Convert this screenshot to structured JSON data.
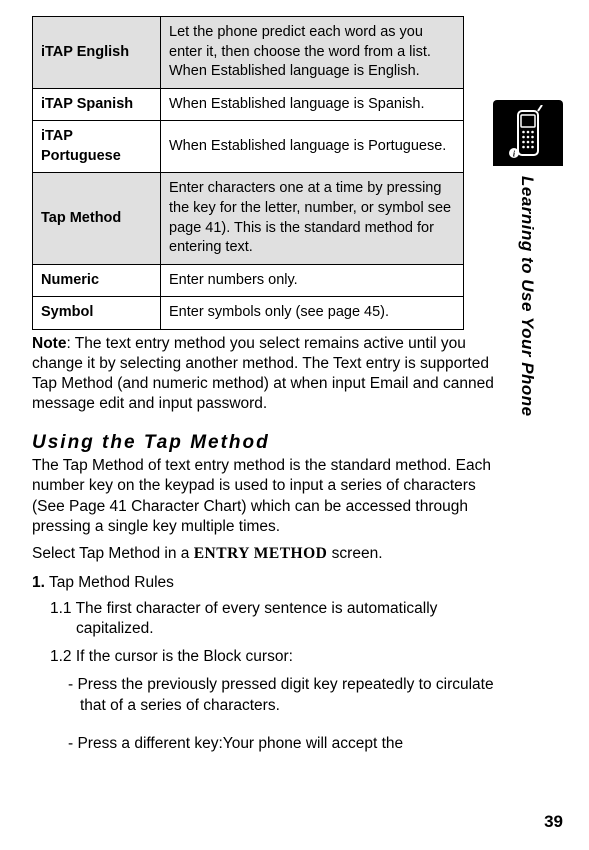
{
  "table": {
    "rows": [
      {
        "label": "iTAP English",
        "desc": "Let the phone predict each word as you enter it, then choose the word from a list. When Established language is English.",
        "shaded": true
      },
      {
        "label": "iTAP Spanish",
        "desc": "When Established language is Spanish.",
        "shaded": false
      },
      {
        "label": "iTAP Portuguese",
        "desc": "When Established language is Portuguese.",
        "shaded": false
      },
      {
        "label": "Tap Method",
        "desc": "Enter characters one at a time by pressing the key for the letter, number, or symbol see page 41). This is the standard method for entering text.",
        "shaded": true
      },
      {
        "label": "Numeric",
        "desc": "Enter numbers only.",
        "shaded": false
      },
      {
        "label": "Symbol",
        "desc": "Enter symbols only (see page 45).",
        "shaded": false
      }
    ]
  },
  "note": {
    "label": "Note",
    "text": ": The text entry method you select remains active until you change it by selecting another method. The Text entry is supported Tap Method (and numeric method) at when input Email and canned message edit and input password."
  },
  "section_heading": "Using the Tap Method",
  "tap_intro": "The Tap Method of text entry method is the standard method. Each number key on the keypad is used to input a series of characters (See Page 41 Character Chart) which can be accessed through pressing a single key multiple times.",
  "select_line_prefix": "Select Tap Method in a ",
  "select_line_entry": "ENTRY METHOD",
  "select_line_suffix": " screen.",
  "list": {
    "num": "1.",
    "title": " Tap Method Rules",
    "item1_1": "1.1 The first character of every sentence is automatically capitalized.",
    "item1_2": "1.2 If the cursor is the Block cursor:",
    "bullet1": "- Press the previously pressed digit key repeatedly to circulate that of a series of characters.",
    "bullet2": "- Press a different key:Your phone will accept the"
  },
  "side_label": "Learning to Use Your Phone",
  "page_number": "39"
}
